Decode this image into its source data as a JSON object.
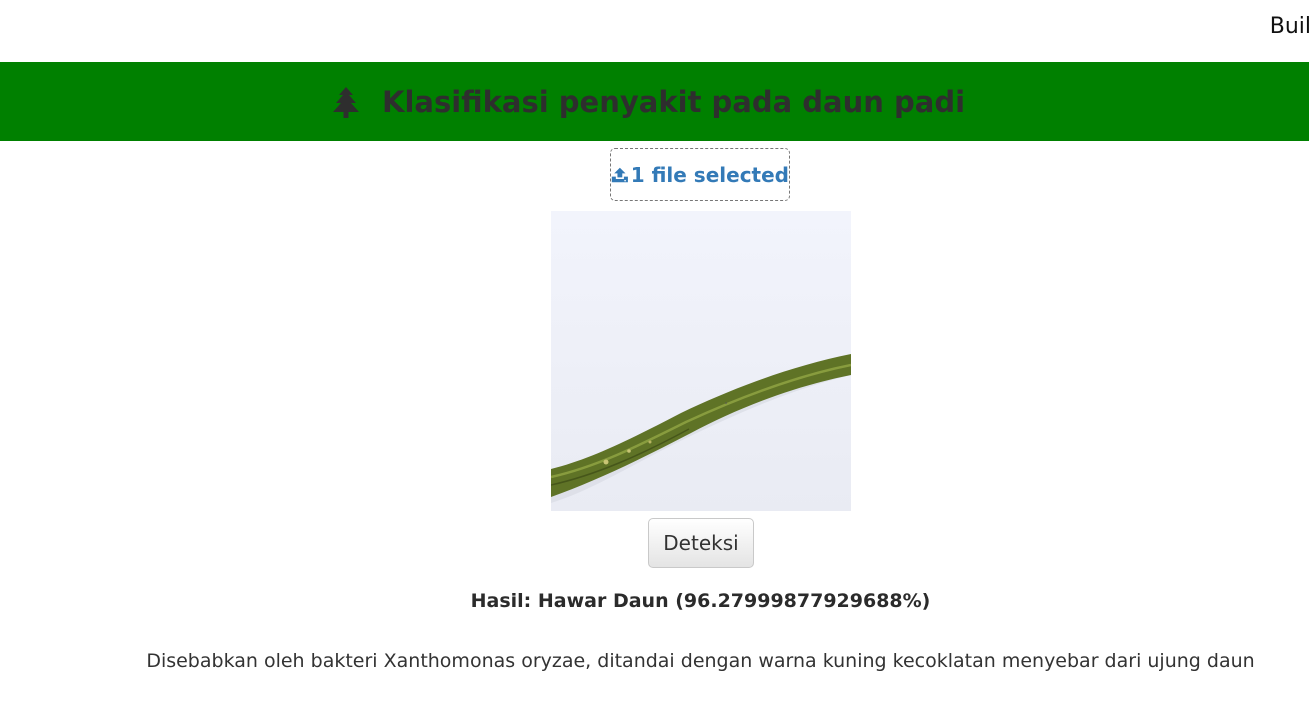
{
  "topbar": {
    "text": "Buil"
  },
  "header": {
    "icon": "tree-icon",
    "title": "Klasifikasi penyakit pada daun padi",
    "background": "#008000"
  },
  "upload": {
    "icon": "upload-icon",
    "label": "1 file selected",
    "color": "#337ab7"
  },
  "preview": {
    "subject": "rice-leaf-photo"
  },
  "detect_button": {
    "label": "Deteksi"
  },
  "result": {
    "text": "Hasil: Hawar Daun (96.27999877929688%)"
  },
  "description": {
    "text": "Disebabkan oleh bakteri Xanthomonas oryzae, ditandai dengan warna kuning kecoklatan menyebar dari ujung daun"
  }
}
